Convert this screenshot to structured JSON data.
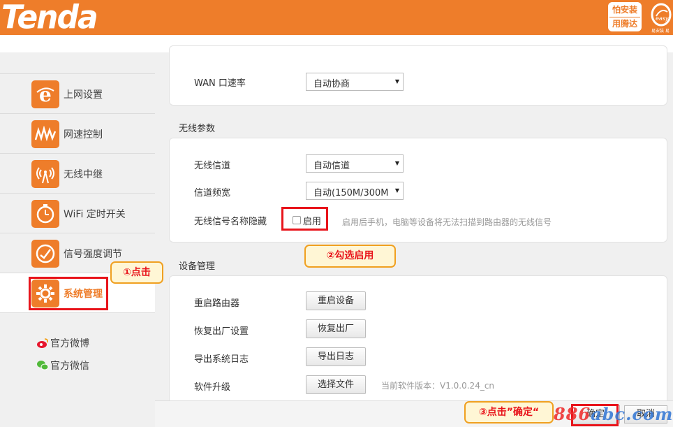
{
  "header": {
    "logo": "Tenda",
    "badge_line1": "怕安装",
    "badge_line2": "用腾达",
    "mark_text": "easy",
    "mark_sub": "易安装 易"
  },
  "sidebar": {
    "items": [
      {
        "label": "上网设置",
        "icon": "e-internet-icon"
      },
      {
        "label": "网速控制",
        "icon": "speed-wave-icon"
      },
      {
        "label": "无线中继",
        "icon": "wireless-relay-icon"
      },
      {
        "label": "WiFi 定时开关",
        "icon": "timer-icon"
      },
      {
        "label": "信号强度调节",
        "icon": "signal-gauge-icon"
      },
      {
        "label": "系统管理",
        "icon": "gear-icon",
        "active": true
      }
    ],
    "social": [
      {
        "label": "官方微博",
        "icon": "weibo-icon"
      },
      {
        "label": "官方微信",
        "icon": "wechat-icon"
      }
    ]
  },
  "wan": {
    "label": "WAN 口速率",
    "value": "自动协商"
  },
  "wireless": {
    "title": "无线参数",
    "channel_label": "无线信道",
    "channel_value": "自动信道",
    "bandwidth_label": "信道频宽",
    "bandwidth_value": "自动(150M/300M",
    "hide_label": "无线信号名称隐藏",
    "enable_label": "启用",
    "enable_checked": false,
    "hint": "启用后手机，电脑等设备将无法扫描到路由器的无线信号"
  },
  "device": {
    "title": "设备管理",
    "rows": [
      {
        "label": "重启路由器",
        "button": "重启设备"
      },
      {
        "label": "恢复出厂设置",
        "button": "恢复出厂"
      },
      {
        "label": "导出系统日志",
        "button": "导出日志"
      },
      {
        "label": "软件升级",
        "button": "选择文件"
      }
    ],
    "version_text": "当前软件版本：V1.0.0.24_cn"
  },
  "footer": {
    "ok_label": "确定",
    "cancel_label": "取消"
  },
  "annotations": {
    "step1": "①点击",
    "step2": "②勾选启用",
    "step3": "③点击”确定“"
  },
  "watermark": {
    "red": "886",
    "blue": "abc",
    "tail": ".com"
  },
  "colors": {
    "brand": "#ee7d2a",
    "annotation_red": "#e8141b",
    "callout_fill": "#fff6d5"
  }
}
